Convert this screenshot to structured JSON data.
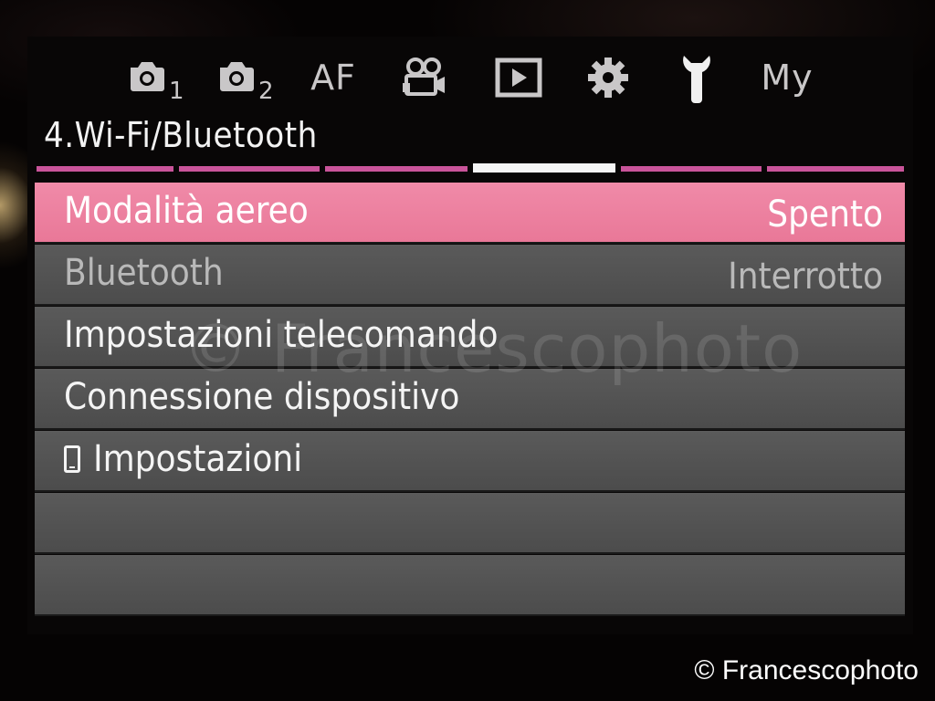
{
  "tabs": [
    {
      "icon": "camera-1-icon",
      "subscript": "1"
    },
    {
      "icon": "camera-2-icon",
      "subscript": "2"
    },
    {
      "icon": "af-tab",
      "text": "AF"
    },
    {
      "icon": "video-camera-icon"
    },
    {
      "icon": "playback-icon"
    },
    {
      "icon": "gear-icon"
    },
    {
      "icon": "wrench-icon",
      "active": true
    },
    {
      "icon": "my-menu-tab",
      "text": "My"
    }
  ],
  "section_title": "4.Wi-Fi/Bluetooth",
  "page_indicator": {
    "total": 6,
    "current": 4
  },
  "menu": {
    "items": [
      {
        "label": "Modalità aereo",
        "value": "Spento",
        "selected": true
      },
      {
        "label": "Bluetooth",
        "value": "Interrotto",
        "disabled": true
      },
      {
        "label": "Impostazioni telecomando",
        "value": ""
      },
      {
        "label": "Connessione dispositivo",
        "value": ""
      },
      {
        "label": "Impostazioni",
        "value": "",
        "icon": "smartphone-icon"
      },
      {
        "label": "",
        "value": ""
      },
      {
        "label": "",
        "value": ""
      }
    ]
  },
  "watermark": {
    "center": "© Francescophoto",
    "corner": "© Francescophoto"
  },
  "colors": {
    "selected_row": "#ee819f",
    "row": "#535353",
    "page_bar": "#c9549a",
    "page_bar_current": "#f5f5f5"
  }
}
